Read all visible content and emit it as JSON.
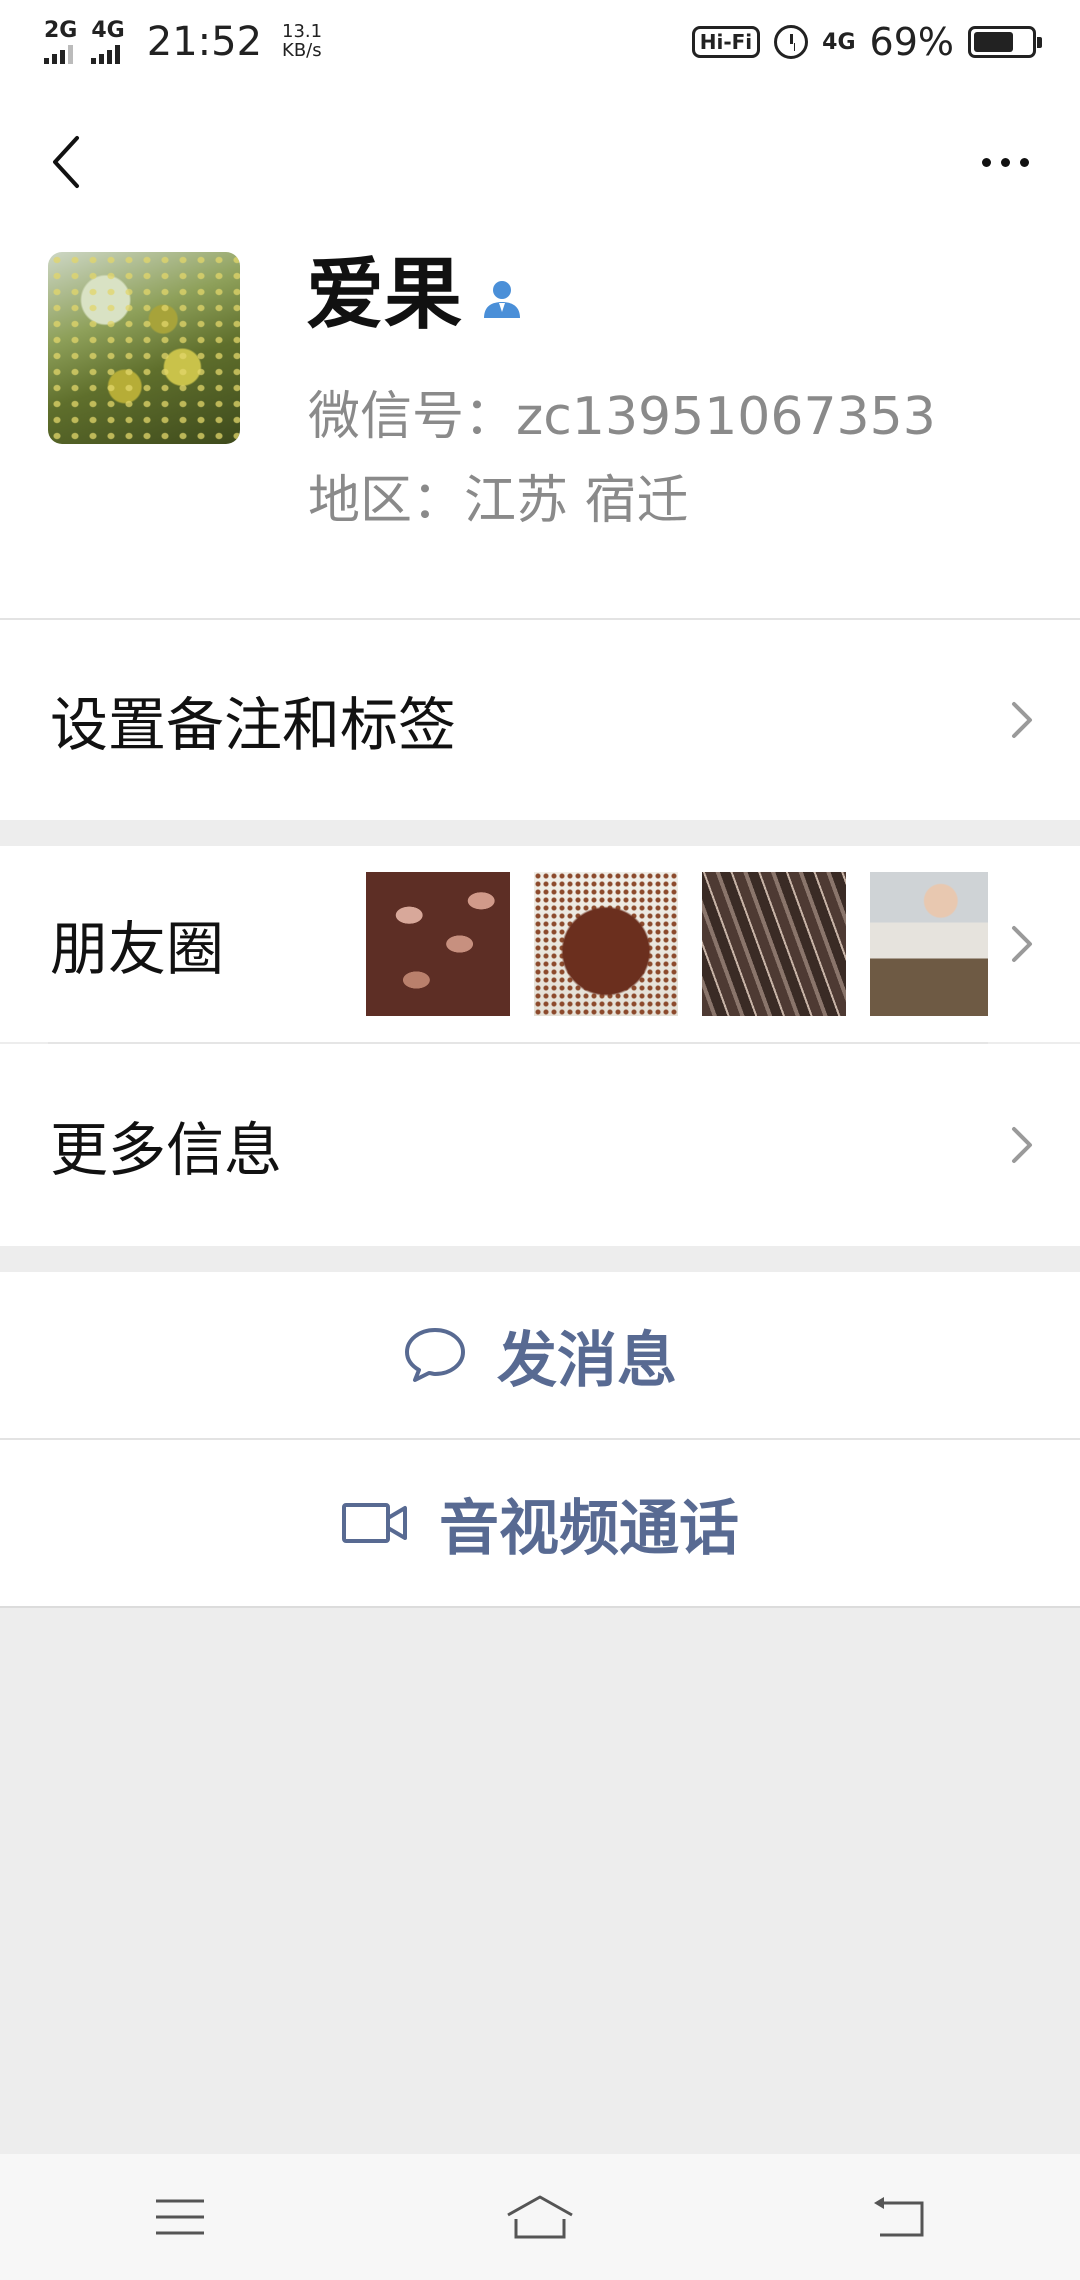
{
  "status_bar": {
    "signal1": "2G",
    "signal2": "4G",
    "time": "21:52",
    "speed_value": "13.1",
    "speed_unit": "KB/s",
    "hifi": "Hi-Fi",
    "network": "4G",
    "battery": "69%",
    "battery_level": 0.69
  },
  "profile": {
    "name": "爱果",
    "wechat_id": "微信号：zc13951067353",
    "region": "地区：江苏  宿迁"
  },
  "rows": {
    "remark_tags": "设置备注和标签",
    "moments": "朋友圈",
    "more_info": "更多信息"
  },
  "actions": {
    "send_message": "发消息",
    "av_call": "音视频通话"
  },
  "colors": {
    "accent": "#586a92",
    "verify": "#4a8fd8"
  }
}
